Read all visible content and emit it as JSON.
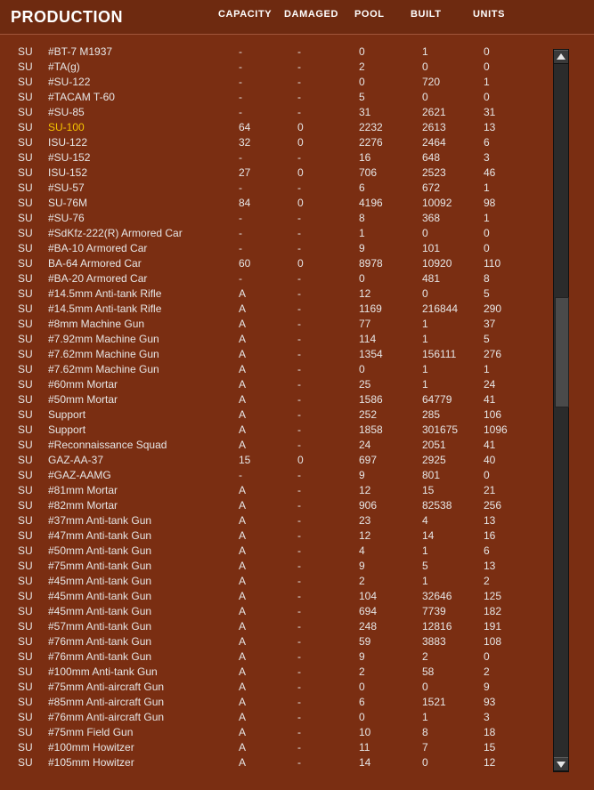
{
  "header": {
    "title": "PRODUCTION",
    "columns": {
      "capacity": "CAPACITY",
      "damaged": "DAMAGED",
      "pool": "POOL",
      "built": "BUILT",
      "units": "UNITS"
    }
  },
  "highlight_color": "#f5c400",
  "highlighted_row_index": 5,
  "rows": [
    {
      "type": "SU",
      "name": "#BT-7 M1937",
      "capacity": "-",
      "damaged": "-",
      "pool": "0",
      "built": "1",
      "units": "0"
    },
    {
      "type": "SU",
      "name": "#TA(g)",
      "capacity": "-",
      "damaged": "-",
      "pool": "2",
      "built": "0",
      "units": "0"
    },
    {
      "type": "SU",
      "name": "#SU-122",
      "capacity": "-",
      "damaged": "-",
      "pool": "0",
      "built": "720",
      "units": "1"
    },
    {
      "type": "SU",
      "name": "#TACAM T-60",
      "capacity": "-",
      "damaged": "-",
      "pool": "5",
      "built": "0",
      "units": "0"
    },
    {
      "type": "SU",
      "name": "#SU-85",
      "capacity": "-",
      "damaged": "-",
      "pool": "31",
      "built": "2621",
      "units": "31"
    },
    {
      "type": "SU",
      "name": "SU-100",
      "capacity": "64",
      "damaged": "0",
      "pool": "2232",
      "built": "2613",
      "units": "13"
    },
    {
      "type": "SU",
      "name": "ISU-122",
      "capacity": "32",
      "damaged": "0",
      "pool": "2276",
      "built": "2464",
      "units": "6"
    },
    {
      "type": "SU",
      "name": "#SU-152",
      "capacity": "-",
      "damaged": "-",
      "pool": "16",
      "built": "648",
      "units": "3"
    },
    {
      "type": "SU",
      "name": "ISU-152",
      "capacity": "27",
      "damaged": "0",
      "pool": "706",
      "built": "2523",
      "units": "46"
    },
    {
      "type": "SU",
      "name": "#SU-57",
      "capacity": "-",
      "damaged": "-",
      "pool": "6",
      "built": "672",
      "units": "1"
    },
    {
      "type": "SU",
      "name": "SU-76M",
      "capacity": "84",
      "damaged": "0",
      "pool": "4196",
      "built": "10092",
      "units": "98"
    },
    {
      "type": "SU",
      "name": "#SU-76",
      "capacity": "-",
      "damaged": "-",
      "pool": "8",
      "built": "368",
      "units": "1"
    },
    {
      "type": "SU",
      "name": "#SdKfz-222(R) Armored Car",
      "capacity": "-",
      "damaged": "-",
      "pool": "1",
      "built": "0",
      "units": "0"
    },
    {
      "type": "SU",
      "name": "#BA-10 Armored Car",
      "capacity": "-",
      "damaged": "-",
      "pool": "9",
      "built": "101",
      "units": "0"
    },
    {
      "type": "SU",
      "name": "BA-64 Armored Car",
      "capacity": "60",
      "damaged": "0",
      "pool": "8978",
      "built": "10920",
      "units": "110"
    },
    {
      "type": "SU",
      "name": "#BA-20 Armored Car",
      "capacity": "-",
      "damaged": "-",
      "pool": "0",
      "built": "481",
      "units": "8"
    },
    {
      "type": "SU",
      "name": "#14.5mm Anti-tank Rifle",
      "capacity": "A",
      "damaged": "-",
      "pool": "12",
      "built": "0",
      "units": "5"
    },
    {
      "type": "SU",
      "name": "#14.5mm Anti-tank Rifle",
      "capacity": "A",
      "damaged": "-",
      "pool": "1169",
      "built": "216844",
      "units": "290"
    },
    {
      "type": "SU",
      "name": "#8mm Machine Gun",
      "capacity": "A",
      "damaged": "-",
      "pool": "77",
      "built": "1",
      "units": "37"
    },
    {
      "type": "SU",
      "name": "#7.92mm Machine Gun",
      "capacity": "A",
      "damaged": "-",
      "pool": "114",
      "built": "1",
      "units": "5"
    },
    {
      "type": "SU",
      "name": "#7.62mm Machine Gun",
      "capacity": "A",
      "damaged": "-",
      "pool": "1354",
      "built": "156111",
      "units": "276"
    },
    {
      "type": "SU",
      "name": "#7.62mm Machine Gun",
      "capacity": "A",
      "damaged": "-",
      "pool": "0",
      "built": "1",
      "units": "1"
    },
    {
      "type": "SU",
      "name": "#60mm Mortar",
      "capacity": "A",
      "damaged": "-",
      "pool": "25",
      "built": "1",
      "units": "24"
    },
    {
      "type": "SU",
      "name": "#50mm Mortar",
      "capacity": "A",
      "damaged": "-",
      "pool": "1586",
      "built": "64779",
      "units": "41"
    },
    {
      "type": "SU",
      "name": "Support",
      "capacity": "A",
      "damaged": "-",
      "pool": "252",
      "built": "285",
      "units": "106"
    },
    {
      "type": "SU",
      "name": "Support",
      "capacity": "A",
      "damaged": "-",
      "pool": "1858",
      "built": "301675",
      "units": "1096"
    },
    {
      "type": "SU",
      "name": "#Reconnaissance Squad",
      "capacity": "A",
      "damaged": "-",
      "pool": "24",
      "built": "2051",
      "units": "41"
    },
    {
      "type": "SU",
      "name": "GAZ-AA-37",
      "capacity": "15",
      "damaged": "0",
      "pool": "697",
      "built": "2925",
      "units": "40"
    },
    {
      "type": "SU",
      "name": "#GAZ-AAMG",
      "capacity": "-",
      "damaged": "-",
      "pool": "9",
      "built": "801",
      "units": "0"
    },
    {
      "type": "SU",
      "name": "#81mm Mortar",
      "capacity": "A",
      "damaged": "-",
      "pool": "12",
      "built": "15",
      "units": "21"
    },
    {
      "type": "SU",
      "name": "#82mm Mortar",
      "capacity": "A",
      "damaged": "-",
      "pool": "906",
      "built": "82538",
      "units": "256"
    },
    {
      "type": "SU",
      "name": "#37mm Anti-tank Gun",
      "capacity": "A",
      "damaged": "-",
      "pool": "23",
      "built": "4",
      "units": "13"
    },
    {
      "type": "SU",
      "name": "#47mm Anti-tank Gun",
      "capacity": "A",
      "damaged": "-",
      "pool": "12",
      "built": "14",
      "units": "16"
    },
    {
      "type": "SU",
      "name": "#50mm Anti-tank Gun",
      "capacity": "A",
      "damaged": "-",
      "pool": "4",
      "built": "1",
      "units": "6"
    },
    {
      "type": "SU",
      "name": "#75mm Anti-tank Gun",
      "capacity": "A",
      "damaged": "-",
      "pool": "9",
      "built": "5",
      "units": "13"
    },
    {
      "type": "SU",
      "name": "#45mm Anti-tank Gun",
      "capacity": "A",
      "damaged": "-",
      "pool": "2",
      "built": "1",
      "units": "2"
    },
    {
      "type": "SU",
      "name": "#45mm Anti-tank Gun",
      "capacity": "A",
      "damaged": "-",
      "pool": "104",
      "built": "32646",
      "units": "125"
    },
    {
      "type": "SU",
      "name": "#45mm Anti-tank Gun",
      "capacity": "A",
      "damaged": "-",
      "pool": "694",
      "built": "7739",
      "units": "182"
    },
    {
      "type": "SU",
      "name": "#57mm Anti-tank Gun",
      "capacity": "A",
      "damaged": "-",
      "pool": "248",
      "built": "12816",
      "units": "191"
    },
    {
      "type": "SU",
      "name": "#76mm Anti-tank Gun",
      "capacity": "A",
      "damaged": "-",
      "pool": "59",
      "built": "3883",
      "units": "108"
    },
    {
      "type": "SU",
      "name": "#76mm Anti-tank Gun",
      "capacity": "A",
      "damaged": "-",
      "pool": "9",
      "built": "2",
      "units": "0"
    },
    {
      "type": "SU",
      "name": "#100mm Anti-tank Gun",
      "capacity": "A",
      "damaged": "-",
      "pool": "2",
      "built": "58",
      "units": "2"
    },
    {
      "type": "SU",
      "name": "#75mm Anti-aircraft Gun",
      "capacity": "A",
      "damaged": "-",
      "pool": "0",
      "built": "0",
      "units": "9"
    },
    {
      "type": "SU",
      "name": "#85mm Anti-aircraft Gun",
      "capacity": "A",
      "damaged": "-",
      "pool": "6",
      "built": "1521",
      "units": "93"
    },
    {
      "type": "SU",
      "name": "#76mm Anti-aircraft Gun",
      "capacity": "A",
      "damaged": "-",
      "pool": "0",
      "built": "1",
      "units": "3"
    },
    {
      "type": "SU",
      "name": "#75mm Field Gun",
      "capacity": "A",
      "damaged": "-",
      "pool": "10",
      "built": "8",
      "units": "18"
    },
    {
      "type": "SU",
      "name": "#100mm Howitzer",
      "capacity": "A",
      "damaged": "-",
      "pool": "11",
      "built": "7",
      "units": "15"
    },
    {
      "type": "SU",
      "name": "#105mm Howitzer",
      "capacity": "A",
      "damaged": "-",
      "pool": "14",
      "built": "0",
      "units": "12"
    }
  ],
  "scrollbar": {
    "up_icon": "arrow-up-icon",
    "down_icon": "arrow-down-icon",
    "scroll_position_fraction": 0.4
  }
}
